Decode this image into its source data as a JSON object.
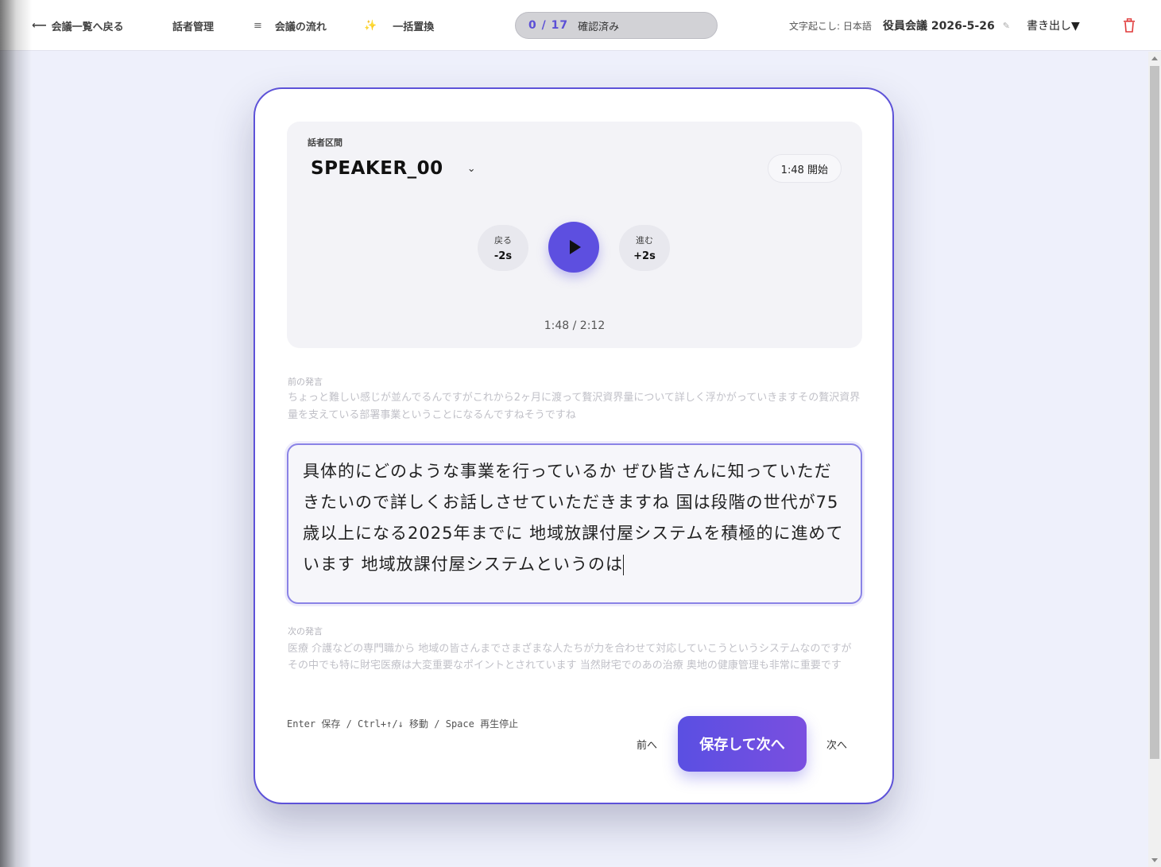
{
  "topbar": {
    "back_label": "会議一覧へ戻る",
    "back_arrow": "⟵",
    "speakers_label": "話者管理",
    "flow_icon": "≡",
    "flow_label": "会議の流れ",
    "replace_icon": "✨",
    "replace_label": "一括置換",
    "progress_count": "0 / 17",
    "progress_label": "確認済み",
    "transcription_lang": "文字起こし: 日本語",
    "meeting_title": "役員会議 2026-5-26",
    "edit_icon": "✎",
    "export_label": "書き出し▼",
    "trash_icon": "trash-icon"
  },
  "player": {
    "segment_label": "話者区間",
    "speaker": "SPEAKER_00",
    "speaker_chevron": "⌄",
    "start_badge": "1:48 開始",
    "back_small": "戻る",
    "back_big": "-2s",
    "fwd_small": "進む",
    "fwd_big": "+2s",
    "time_readout": "1:48 / 2:12"
  },
  "context": {
    "prev_label": "前の発言",
    "prev_text": "ちょっと難しい感じが並んでるんですがこれから2ヶ月に渡って贅沢資界量について詳しく浮かがっていきますその贅沢資界量を支えている部署事業ということになるんですねそうですね",
    "current_text": "具体的にどのような事業を行っているか ぜひ皆さんに知っていただきたいので詳しくお話しさせていただきますね 国は段階の世代が75歳以上になる2025年までに 地域放課付屋システムを積極的に進めています 地域放課付屋システムというのは",
    "next_label": "次の発言",
    "next_text": "医療 介護などの専門職から 地域の皆さんまでさまざまな人たちが力を合わせて対応していこうというシステムなのですが その中でも特に財宅医療は大変重要なポイントとされています 当然財宅でのあの治療 奥地の健康管理も非常に重要です"
  },
  "footer": {
    "shortcut_hint": "Enter 保存 / Ctrl+↑/↓ 移動 / Space 再生停止",
    "prev_button": "前へ",
    "save_next_button": "保存して次へ",
    "next_button": "次へ"
  },
  "colors": {
    "accent": "#5d4fe0",
    "trash": "#e03a3a",
    "background": "#eef0fb"
  }
}
